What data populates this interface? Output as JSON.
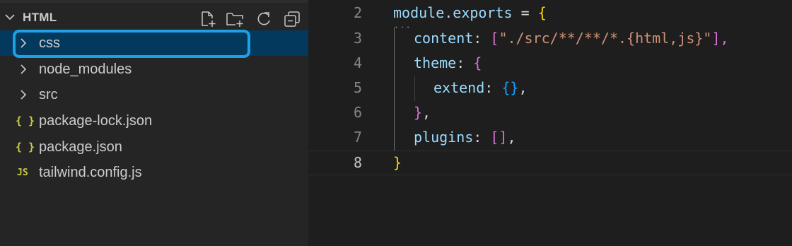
{
  "explorer": {
    "title": "HTML",
    "header_icons": [
      "new-file-icon",
      "new-folder-icon",
      "refresh-icon",
      "collapse-all-icon"
    ],
    "items": [
      {
        "label": "css",
        "type": "folder",
        "selected": true
      },
      {
        "label": "node_modules",
        "type": "folder"
      },
      {
        "label": "src",
        "type": "folder"
      },
      {
        "label": "package-lock.json",
        "type": "json",
        "icon_text": "{ }"
      },
      {
        "label": "package.json",
        "type": "json",
        "icon_text": "{ }"
      },
      {
        "label": "tailwind.config.js",
        "type": "js",
        "icon_text": "JS"
      }
    ]
  },
  "editor": {
    "active_line": "8",
    "lines": [
      {
        "number": "2",
        "t1": "module",
        "t2": ".",
        "t3": "exports",
        "t4": " = ",
        "t5": "{"
      },
      {
        "number": "3",
        "t1": "content",
        "t2": ": ",
        "t3": "[",
        "t4": "\"./src/**/**/*.{html,js}\"",
        "t5": "],"
      },
      {
        "number": "4",
        "t1": "theme",
        "t2": ": ",
        "t3": "{"
      },
      {
        "number": "5",
        "t1": "extend",
        "t2": ": ",
        "t3": "{}",
        "t4": ","
      },
      {
        "number": "6",
        "t1": "}",
        "t2": ","
      },
      {
        "number": "7",
        "t1": "plugins",
        "t2": ": ",
        "t3": "[]",
        "t4": ","
      },
      {
        "number": "8",
        "t1": "}"
      }
    ]
  },
  "colors": {
    "selection_bg": "#04395e",
    "focus_ring": "#1ea0e6",
    "bracket_gold": "#ffd700",
    "bracket_pink": "#da70d6",
    "bracket_blue": "#179fff",
    "string": "#ce9178",
    "property": "#9cdcfe"
  }
}
